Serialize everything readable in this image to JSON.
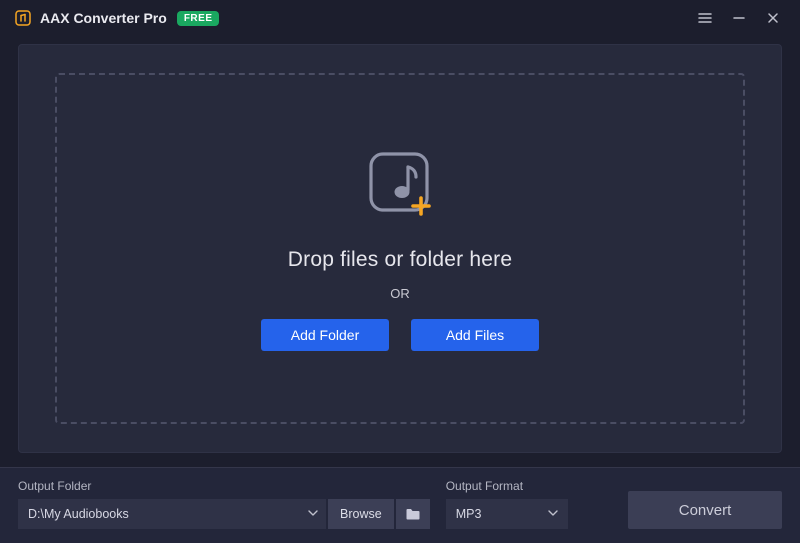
{
  "titlebar": {
    "app_title": "AAX Converter Pro",
    "badge": "FREE"
  },
  "dropzone": {
    "heading": "Drop files or folder here",
    "or": "OR",
    "add_folder_label": "Add Folder",
    "add_files_label": "Add Files"
  },
  "output_folder": {
    "label": "Output Folder",
    "path": "D:\\My Audiobooks",
    "browse_label": "Browse"
  },
  "output_format": {
    "label": "Output Format",
    "selected": "MP3"
  },
  "convert_label": "Convert"
}
